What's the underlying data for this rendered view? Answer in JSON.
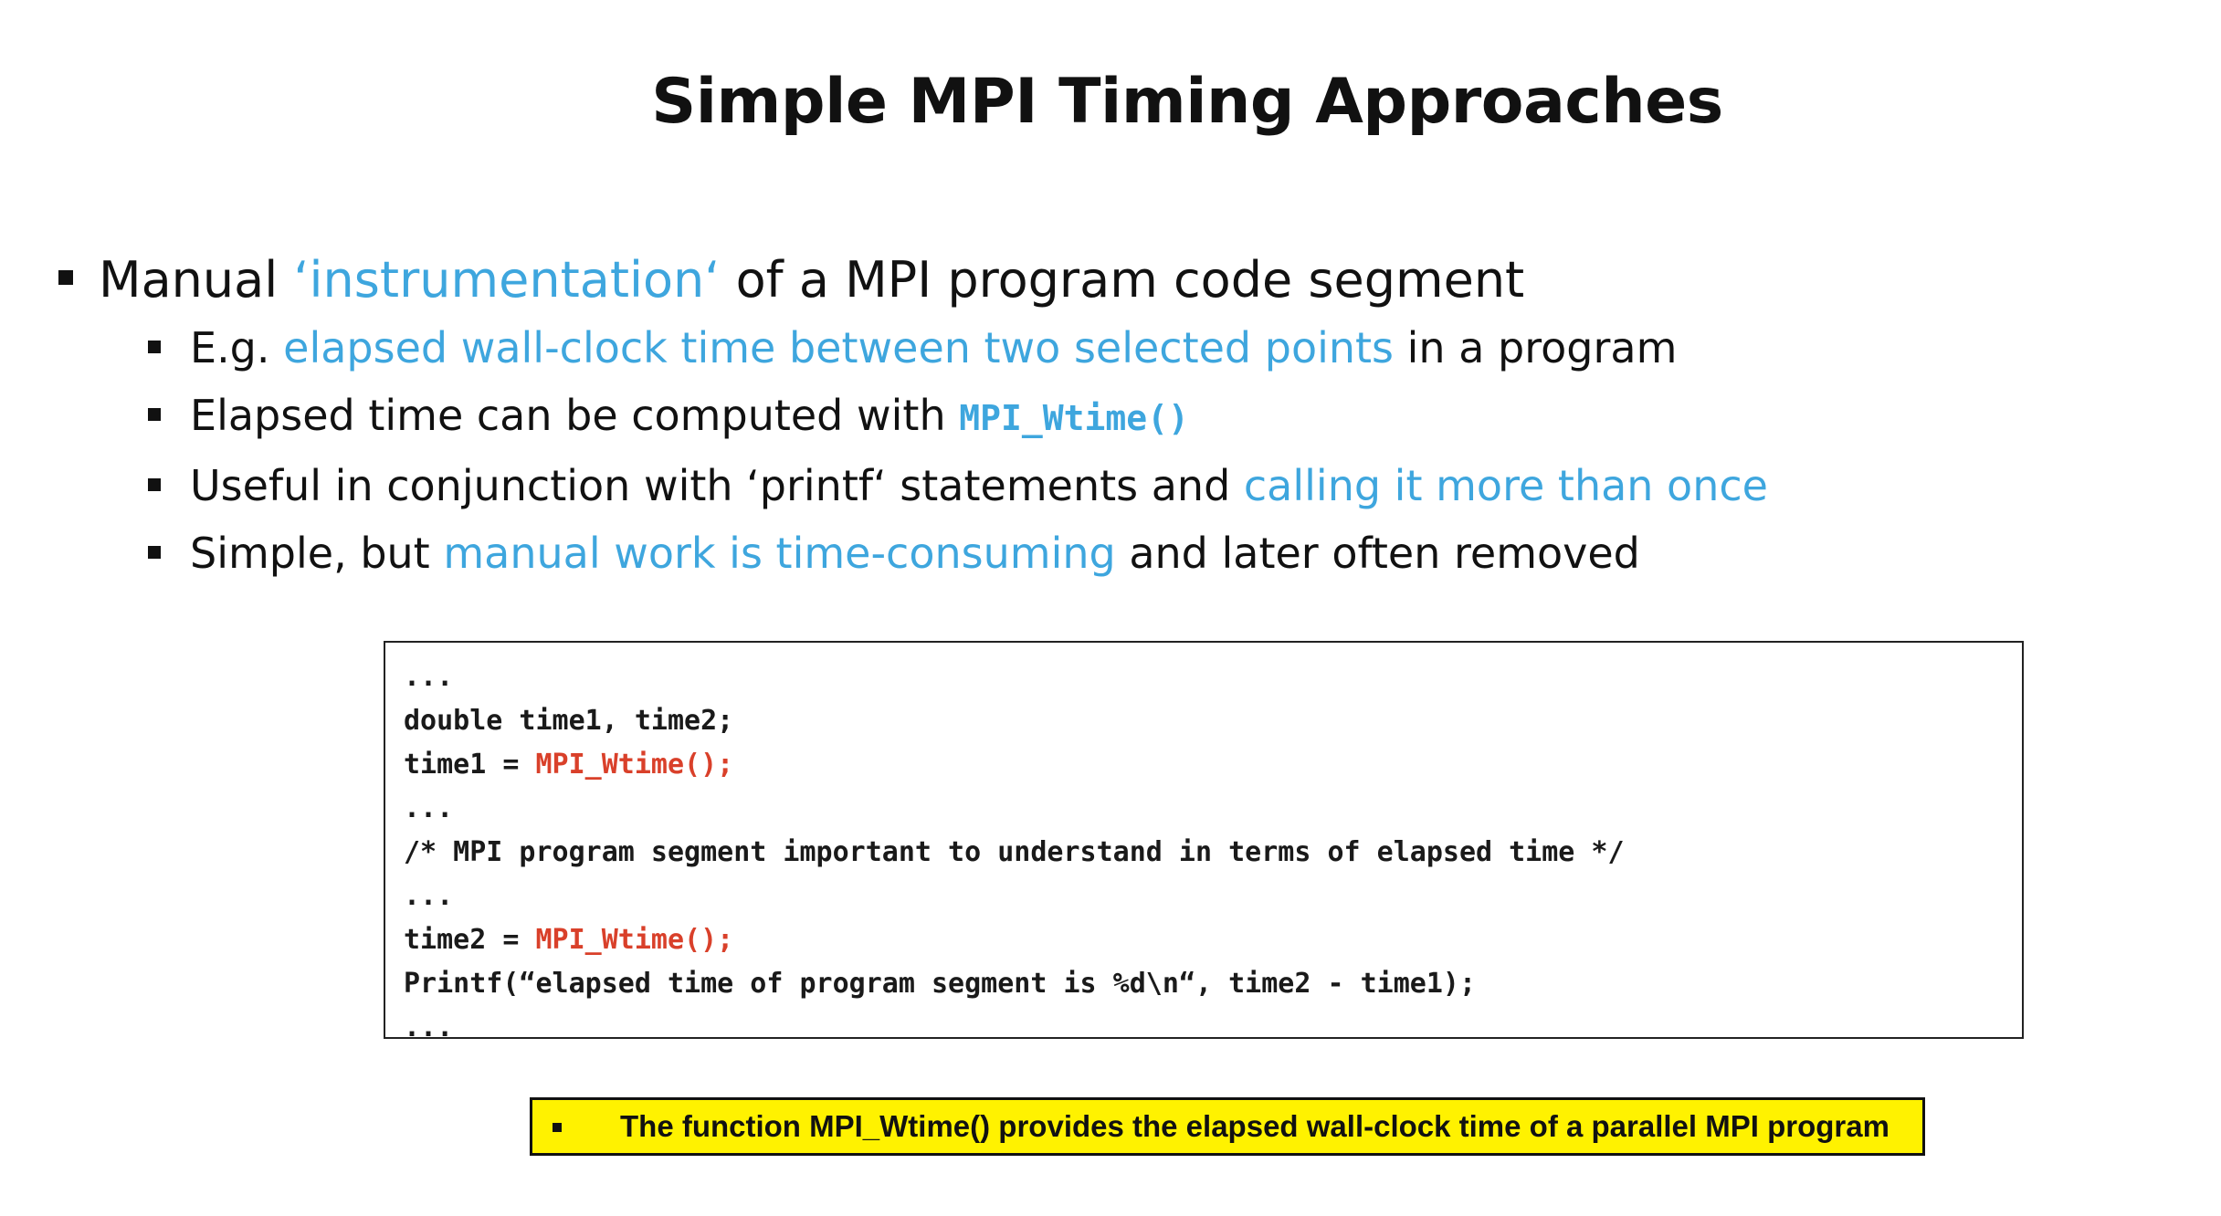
{
  "slide": {
    "title": "Simple MPI Timing Approaches"
  },
  "bullets": {
    "main": {
      "text_before": "Manual ",
      "highlight": "‘instrumentation‘",
      "text_after": " of a MPI program code segment"
    },
    "sub": [
      {
        "before": "E.g. ",
        "highlight": "elapsed wall-clock time between two selected points",
        "after": " in a program"
      },
      {
        "before": "Elapsed time can be computed with ",
        "code": "MPI_Wtime()",
        "after": ""
      },
      {
        "before": "Useful in conjunction with ‘printf‘ statements and ",
        "highlight": "calling it more than once",
        "after": ""
      },
      {
        "before": "Simple, but ",
        "highlight": "manual work is time-consuming",
        "after": " and later often removed"
      }
    ]
  },
  "code": {
    "l1": "...",
    "l2": "double time1, time2;",
    "l3_a": "time1 = ",
    "l3_b": "MPI_Wtime();",
    "l4": "...",
    "l5": "/* MPI program segment important to understand in terms of elapsed time */",
    "l6": "...",
    "l7_a": "time2 = ",
    "l7_b": "MPI_Wtime();",
    "l8": "Printf(“elapsed time of program segment is %d\\n“, time2 - time1);",
    "l9": "..."
  },
  "note": {
    "text": "The function MPI_Wtime() provides the elapsed wall-clock time of a parallel MPI program"
  },
  "colors": {
    "highlight": "#3ea6de",
    "code_red": "#d9402a",
    "note_bg": "#fff200"
  }
}
